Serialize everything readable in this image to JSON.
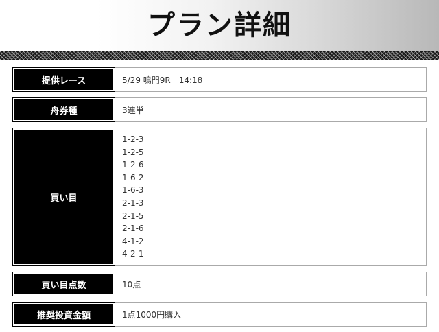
{
  "header": {
    "title": "プラン詳細"
  },
  "plan": {
    "race": {
      "label": "提供レース",
      "value": "5/29 鳴門9R　14:18"
    },
    "ticket_type": {
      "label": "舟券種",
      "value": "3連単"
    },
    "combinations": {
      "label": "買い目",
      "items": [
        "1-2-3",
        "1-2-5",
        "1-2-6",
        "1-6-2",
        "1-6-3",
        "2-1-3",
        "2-1-5",
        "2-1-6",
        "4-1-2",
        "4-2-1"
      ]
    },
    "point_count": {
      "label": "買い目点数",
      "value": "10点"
    },
    "recommended_amount": {
      "label": "推奨投資金額",
      "value": "1点1000円購入"
    }
  }
}
